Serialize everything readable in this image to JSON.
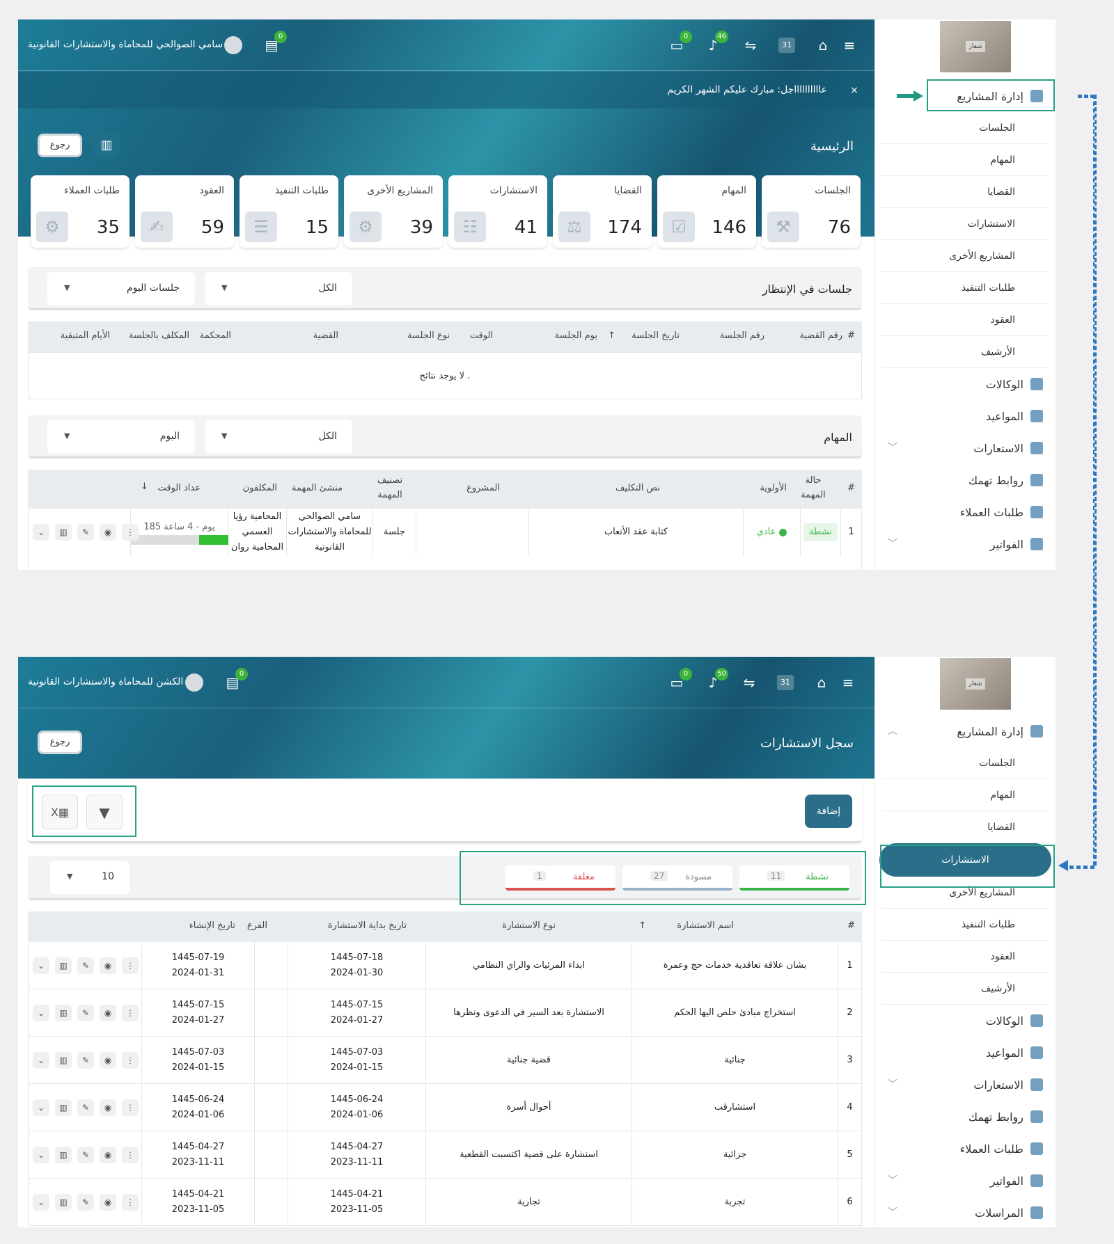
{
  "s1": {
    "firm_name": "سامي الصوالحي للمحاماة والاستشارات القانونية",
    "chat_badge": "0",
    "msg_badge": "0",
    "bell_badge": "46",
    "calendar_day": "31",
    "notice": "عااااااااااجل: مبارك عليكم الشهر الكريم",
    "notice_close": "×",
    "page_title": "الرئيسية",
    "back": "رجوع",
    "logo_text": "شعار",
    "cards": [
      {
        "label": "الجلسات",
        "value": "76",
        "icon": "gavel-icon"
      },
      {
        "label": "المهام",
        "value": "146",
        "icon": "calendar-check-icon"
      },
      {
        "label": "القضايا",
        "value": "174",
        "icon": "scales-icon"
      },
      {
        "label": "الاستشارات",
        "value": "41",
        "icon": "consult-icon"
      },
      {
        "label": "المشاريع الأخرى",
        "value": "39",
        "icon": "project-icon"
      },
      {
        "label": "طلبات التنفيذ",
        "value": "15",
        "icon": "clipboard-icon"
      },
      {
        "label": "العقود",
        "value": "59",
        "icon": "contract-icon"
      },
      {
        "label": "طلبات العملاء",
        "value": "35",
        "icon": "clients-gear-icon"
      }
    ],
    "sessions": {
      "title": "جلسات في الإنتظار",
      "filter1": "الكل",
      "filter2": "جلسات اليوم",
      "cols": [
        "#",
        "رقم القضية",
        "رقم الجلسة",
        "تاريخ الجلسة",
        "يوم الجلسة",
        "الوقت",
        "نوع الجلسة",
        "القضية",
        "المحكمة",
        "المكلف بالجلسة",
        "الأيام المتبقية"
      ],
      "empty": "لا يوجد نتائج ."
    },
    "tasks": {
      "title": "المهام",
      "filter1": "الكل",
      "filter2": "اليوم",
      "cols": [
        "#",
        "حالة المهمة",
        "الأولوية",
        "نص التكليف",
        "المشروع",
        "تصنيف المهمة",
        "منشئ المهمة",
        "المكلفون",
        "عداد الوقت"
      ],
      "row": {
        "num": "1",
        "status": "نشطة",
        "priority": "عادي",
        "text": "كتابة عقد الأتعاب",
        "project": "",
        "category": "جلسة",
        "creator": "سامي الصوالحي للمحاماة والاستشارات القانونية",
        "assignees": "المحامية رؤيا العسمي المحامية روان",
        "timer": "185 يوم - 4 ساعة",
        "progress": 0.3
      }
    },
    "menu": [
      "إدارة المشاريع",
      "الجلسات",
      "المهام",
      "القضايا",
      "الاستشارات",
      "المشاريع الأخرى",
      "طلبات التنفيذ",
      "العقود",
      "الأرشيف",
      "الوكالات",
      "المواعيد",
      "الاستعارات",
      "روابط تهمك",
      "طلبات العملاء",
      "الفواتير"
    ]
  },
  "s2": {
    "firm_name": "الكشن للمحاماة والاستشارات القانونية",
    "chat_badge": "0",
    "msg_badge": "0",
    "bell_badge": "50",
    "calendar_day": "31",
    "page_title": "سجل الاستشارات",
    "back": "رجوع",
    "add": "إضافة",
    "logo_text": "شعار",
    "status_tabs": [
      {
        "label": "نشطة",
        "count": "11",
        "color": "#3bb54a"
      },
      {
        "label": "مسودة",
        "count": "27",
        "color": "#9ab3c8"
      },
      {
        "label": "مغلقة",
        "count": "1",
        "color": "#d9534f"
      }
    ],
    "page_size": "10",
    "cols": [
      "#",
      "اسم الاستشارة",
      "نوع الاستشارة",
      "تاريخ بداية الاستشارة",
      "الفرع",
      "تاريخ الإنشاء"
    ],
    "rows": [
      {
        "n": "1",
        "name": "بشان علاقة تعاقدية خدمات حج وعمرة",
        "type": "ابداء المرئيات والراي النظامي",
        "start_h": "1445-07-18",
        "start_g": "2024-01-30",
        "branch": "",
        "created_h": "1445-07-19",
        "created_g": "2024-01-31"
      },
      {
        "n": "2",
        "name": "استخراج مبادئ حلص اليها الحكم",
        "type": "الاستشارة بعد السير في الدعوى ونظرها",
        "start_h": "1445-07-15",
        "start_g": "2024-01-27",
        "branch": "",
        "created_h": "1445-07-15",
        "created_g": "2024-01-27"
      },
      {
        "n": "3",
        "name": "جنائية",
        "type": "قضية جنائية",
        "start_h": "1445-07-03",
        "start_g": "2024-01-15",
        "branch": "",
        "created_h": "1445-07-03",
        "created_g": "2024-01-15"
      },
      {
        "n": "4",
        "name": "استشارقب",
        "type": "أحوال أسرة",
        "start_h": "1445-06-24",
        "start_g": "2024-01-06",
        "branch": "",
        "created_h": "1445-06-24",
        "created_g": "2024-01-06"
      },
      {
        "n": "5",
        "name": "جزائية",
        "type": "استشارة على قضية اكتسبت القطعية",
        "start_h": "1445-04-27",
        "start_g": "2023-11-11",
        "branch": "",
        "created_h": "1445-04-27",
        "created_g": "2023-11-11"
      },
      {
        "n": "6",
        "name": "تجربة",
        "type": "تجارية",
        "start_h": "1445-04-21",
        "start_g": "2023-11-05",
        "branch": "",
        "created_h": "1445-04-21",
        "created_g": "2023-11-05"
      }
    ],
    "menu": [
      "إدارة المشاريع",
      "الجلسات",
      "المهام",
      "القضايا",
      "الاستشارات",
      "المشاريع الأخرى",
      "طلبات التنفيذ",
      "العقود",
      "الأرشيف",
      "الوكالات",
      "المواعيد",
      "الاستعارات",
      "روابط تهمك",
      "طلبات العملاء",
      "الفواتير",
      "المراسلات"
    ]
  },
  "colors": {
    "teal": "#1f6f8b",
    "accent_green": "#27a085",
    "arrow_blue": "#2f77c0"
  }
}
